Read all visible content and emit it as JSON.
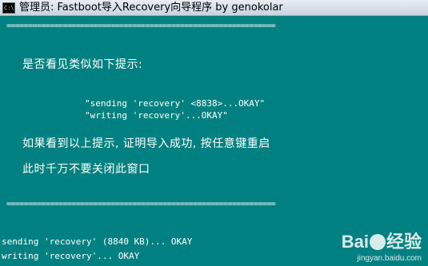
{
  "window": {
    "title": "管理员:  Fastboot导入Recovery向导程序 by genokolar",
    "icon_text": "C:\\"
  },
  "console": {
    "separator": "==============================================================",
    "prompt_question": "是否看见类似如下提示:",
    "example_line_1": "\"sending 'recovery' <8838>...OKAY\"",
    "example_line_2": "\"writing 'recovery'...OKAY\"",
    "success_note": "如果看到以上提示, 证明导入成功, 按任意键重启",
    "warning_note": "此时千万不要关闭此窗口",
    "output_line_1": "sending 'recovery' (8840 KB)... OKAY",
    "output_line_2": "writing 'recovery'... OKAY"
  },
  "watermark": {
    "brand_left": "Bai",
    "brand_right": "经验",
    "url": "jingyan.baidu.com"
  }
}
